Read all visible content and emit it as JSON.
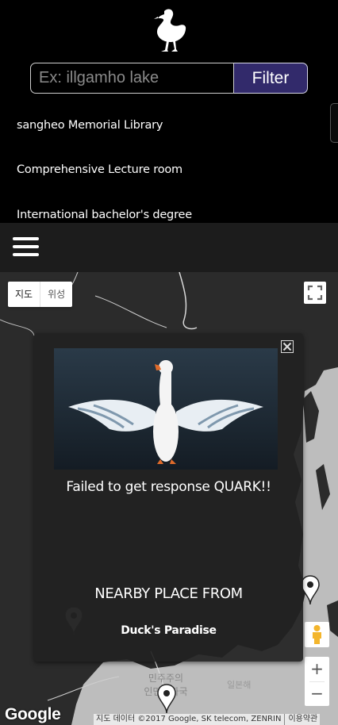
{
  "header": {
    "logo": "duck-logo",
    "search": {
      "value": "",
      "placeholder": "Ex: illgamho lake"
    },
    "filter_label": "Filter",
    "places": [
      "sangheo Memorial Library",
      "Comprehensive Lecture room",
      "International bachelor's degree"
    ]
  },
  "navbar": {
    "menu_icon": "hamburger-icon"
  },
  "map": {
    "map_type": {
      "map": "지도",
      "satellite": "위성"
    },
    "labels": {
      "sea": "일본해",
      "country_line1": "민주주의",
      "country_line2": "인민공화국"
    },
    "google": "Google",
    "attribution": "지도 데이터 ©2017 Google, SK telecom, ZENRIN",
    "terms": "이용약관",
    "zoom_in": "+",
    "zoom_out": "−",
    "colors": {
      "land": "#2b2b2b",
      "water": "#bdbdbd",
      "roads": "#d8d8d8"
    }
  },
  "info_window": {
    "error": "Failed to get response QUARK!!",
    "nearby_heading": "NEARBY PLACE FROM",
    "nearby_place": "Duck's Paradise",
    "accent": "#322a6b"
  }
}
